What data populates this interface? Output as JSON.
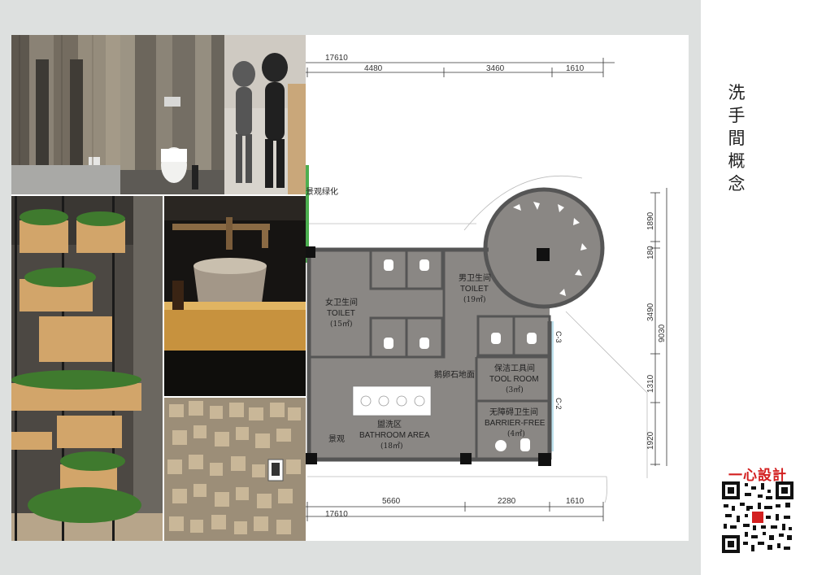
{
  "title": [
    "洗",
    "手",
    "間",
    "概",
    "念"
  ],
  "brand": "一心設計",
  "plan": {
    "top_total": "17610",
    "top_dims": [
      "4480",
      "3460",
      "1610"
    ],
    "bottom_dims": [
      "5660",
      "2280",
      "1610"
    ],
    "bottom_total": "17610",
    "right_dims": [
      "1890",
      "180",
      "3490",
      "1310",
      "1920"
    ],
    "right_total": "9030",
    "landscape_top": "景观绿化",
    "landscape_bottom": "景观",
    "pebble_floor": "鹅卵石地面",
    "rooms": {
      "female_cn": "女卫生间",
      "female_en": "TOILET",
      "female_area": "(15㎡)",
      "male_cn": "男卫生间",
      "male_en": "TOILET",
      "male_area": "(19㎡)",
      "tool_cn": "保洁工具间",
      "tool_en": "TOOL ROOM",
      "tool_area": "(3㎡)",
      "barrier_cn": "无障碍卫生间",
      "barrier_en": "BARRIER-FREE",
      "barrier_area": "(4㎡)",
      "wash_cn": "盥洗区",
      "wash_en": "BATHROOM AREA",
      "wash_area": "(18㎡)"
    },
    "section_marks": [
      "C-3",
      "C-2"
    ]
  },
  "photos": [
    "toilet-stalls-photo",
    "wall-mounted-toilet-photo",
    "mannequin-figures-photo",
    "planter-shelves-photo",
    "bucket-sink-photo",
    "wooden-block-wall-photo"
  ]
}
